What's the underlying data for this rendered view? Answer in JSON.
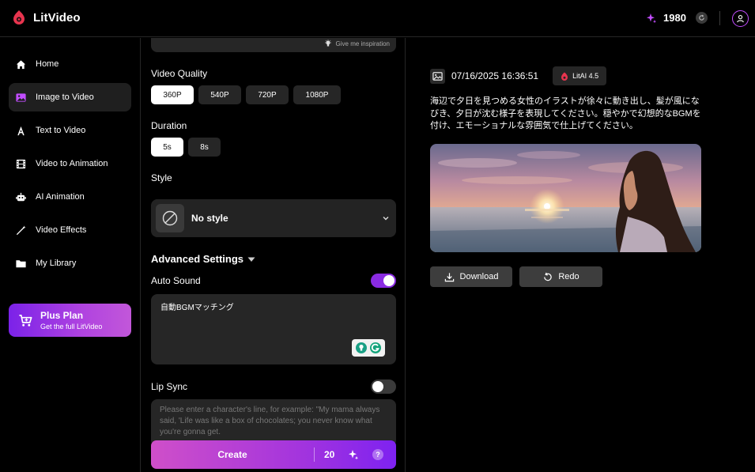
{
  "app": {
    "name": "LitVideo",
    "credits": "1980"
  },
  "sidebar": {
    "items": [
      {
        "label": "Home",
        "icon": "home-icon"
      },
      {
        "label": "Image to Video",
        "icon": "image-icon",
        "active": true
      },
      {
        "label": "Text to Video",
        "icon": "text-icon"
      },
      {
        "label": "Video to Animation",
        "icon": "film-icon"
      },
      {
        "label": "AI Animation",
        "icon": "robot-icon"
      },
      {
        "label": "Video Effects",
        "icon": "wand-icon"
      },
      {
        "label": "My Library",
        "icon": "folder-icon"
      }
    ],
    "plan": {
      "title": "Plus Plan",
      "subtitle": "Get the full LitVideo"
    }
  },
  "form": {
    "inspiration_label": "Give me inspiration",
    "quality": {
      "label": "Video Quality",
      "options": [
        "360P",
        "540P",
        "720P",
        "1080P"
      ],
      "selected": "360P"
    },
    "duration": {
      "label": "Duration",
      "options": [
        "5s",
        "8s"
      ],
      "selected": "5s"
    },
    "style": {
      "label": "Style",
      "value": "No style"
    },
    "advanced_label": "Advanced Settings",
    "auto_sound": {
      "label": "Auto Sound",
      "enabled": true,
      "text": "自動BGMマッチング"
    },
    "lip_sync": {
      "label": "Lip Sync",
      "enabled": false,
      "placeholder": "Please enter a character's line, for example: \"My mama always said, 'Life was like a box of chocolates; you never know what you're gonna get."
    },
    "create": {
      "label": "Create",
      "cost": "20",
      "help": "?"
    }
  },
  "result": {
    "timestamp": "07/16/2025 16:36:51",
    "model": "LitAI 4.5",
    "prompt": "海辺で夕日を見つめる女性のイラストが徐々に動き出し、髪が風になびき、夕日が沈む様子を表現してください。穏やかで幻想的なBGMを付け、エモーショナルな雰囲気で仕上げてください。",
    "download_label": "Download",
    "redo_label": "Redo"
  },
  "colors": {
    "accent": "#8a2be2",
    "brand": "#c24dff",
    "logo": "#e8344e"
  }
}
